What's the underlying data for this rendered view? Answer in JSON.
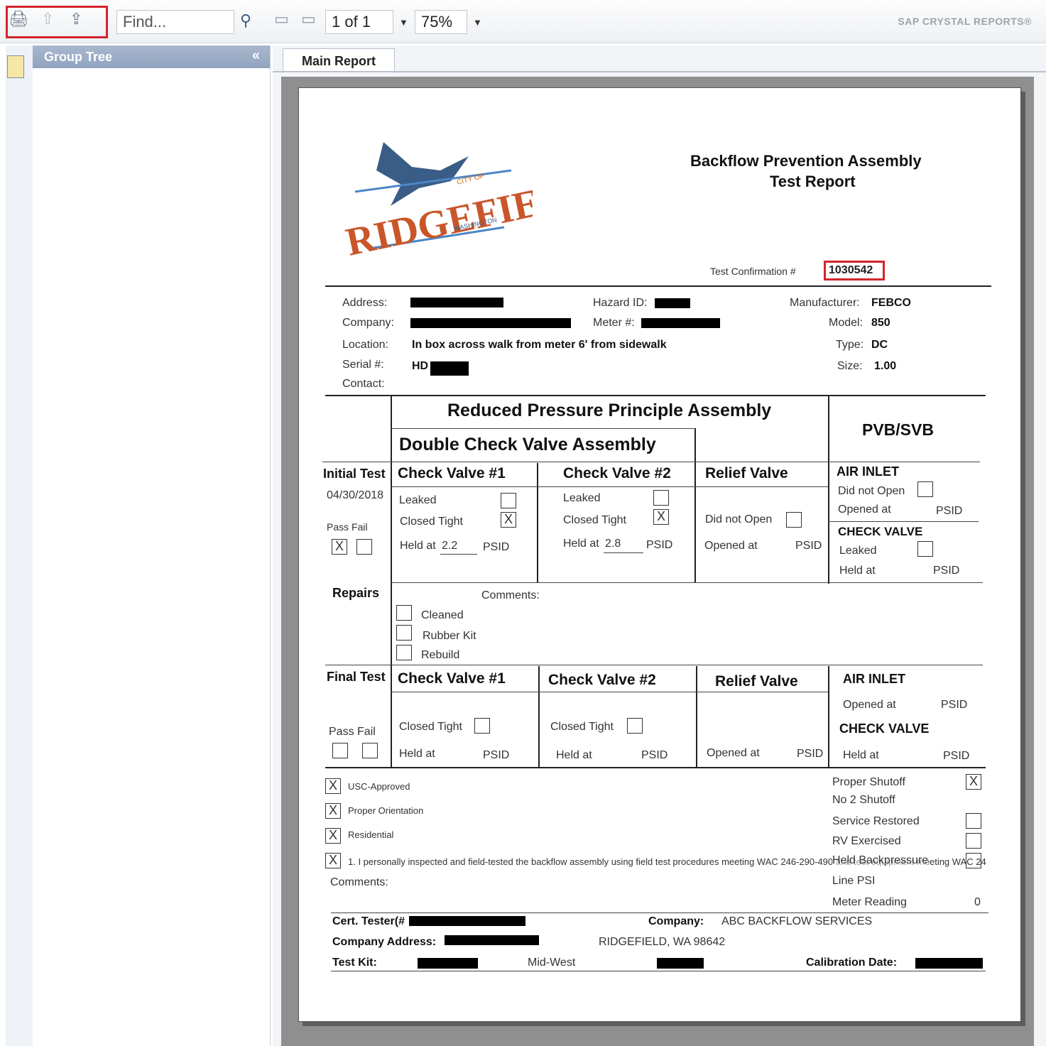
{
  "toolbar": {
    "find_placeholder": "Find...",
    "page_indicator": "1 of 1",
    "zoom": "75%",
    "brand": "SAP CRYSTAL REPORTS®"
  },
  "group_tree": {
    "title": "Group Tree",
    "collapse_glyph": "«"
  },
  "tabs": [
    {
      "label": "Main Report",
      "active": true
    }
  ],
  "report": {
    "title_line1": "Backflow Prevention Assembly",
    "title_line2": "Test Report",
    "logo": {
      "city_of": "CITY OF",
      "name": "RIDGEFIELD",
      "state": "WASHINGTON"
    },
    "test_confirmation_label": "Test Confirmation #",
    "test_confirmation_value": "1030542",
    "info": {
      "address_label": "Address:",
      "company_label": "Company:",
      "location_label": "Location:",
      "location_value": "In box across walk from meter 6' from sidewalk",
      "serial_label": "Serial #:",
      "serial_value": "HD",
      "contact_label": "Contact:",
      "hazard_label": "Hazard ID:",
      "meter_label": "Meter #:",
      "manufacturer_label": "Manufacturer:",
      "manufacturer_value": "FEBCO",
      "model_label": "Model:",
      "model_value": "850",
      "type_label": "Type:",
      "type_value": "DC",
      "size_label": "Size:",
      "size_value": "1.00"
    },
    "section_headers": {
      "rppa": "Reduced Pressure Principle Assembly",
      "dcva": "Double Check Valve Assembly",
      "pvb": "PVB/SVB"
    },
    "initial": {
      "label": "Initial Test",
      "date": "04/30/2018",
      "pass_fail": "Pass  Fail",
      "check_valve_1": "Check Valve #1",
      "check_valve_2": "Check Valve #2",
      "relief_valve": "Relief Valve",
      "leaked": "Leaked",
      "closed_tight": "Closed Tight",
      "held_at": "Held at",
      "cv1_held_value": "2.2",
      "cv2_held_value": "2.8",
      "psid": "PSID",
      "did_not_open": "Did not Open",
      "opened_at": "Opened at",
      "air_inlet": "AIR INLET",
      "check_valve": "CHECK VALVE"
    },
    "repairs": {
      "label": "Repairs",
      "comments": "Comments:",
      "cleaned": "Cleaned",
      "rubber_kit": "Rubber Kit",
      "rebuild": "Rebuild"
    },
    "final": {
      "label": "Final Test",
      "pass_fail": "Pass  Fail",
      "check_valve_1": "Check Valve #1",
      "check_valve_2": "Check Valve #2",
      "relief_valve": "Relief Valve",
      "closed_tight": "Closed Tight",
      "held_at": "Held at",
      "psid": "PSID",
      "opened_at": "Opened at",
      "air_inlet": "AIR INLET",
      "check_valve": "CHECK VALVE"
    },
    "checks_left": {
      "usc": "USC-Approved",
      "orientation": "Proper Orientation",
      "residential": "Residential",
      "certification": "1. I personally inspected and field-tested the backflow assembly using field test procedures meeting WAC 246-290-490 and test equipment meeting WAC 24",
      "comments": "Comments:"
    },
    "checks_right": {
      "proper_shutoff": "Proper Shutoff",
      "no2_shutoff": "No 2 Shutoff",
      "service_restored": "Service Restored",
      "rv_exercised": "RV Exercised",
      "held_backpressure": "Held Backpressure",
      "line_psi": "Line PSI",
      "meter_reading": "Meter Reading",
      "meter_reading_value": "0"
    },
    "footer": {
      "cert_tester": "Cert. Tester(#",
      "company_label": "Company:",
      "company_value": "ABC BACKFLOW SERVICES",
      "company_address": "Company Address:",
      "city": "RIDGEFIELD, WA 98642",
      "test_kit": "Test Kit:",
      "kit_brand": "Mid-West",
      "calibration": "Calibration Date:"
    },
    "mark": "X"
  }
}
